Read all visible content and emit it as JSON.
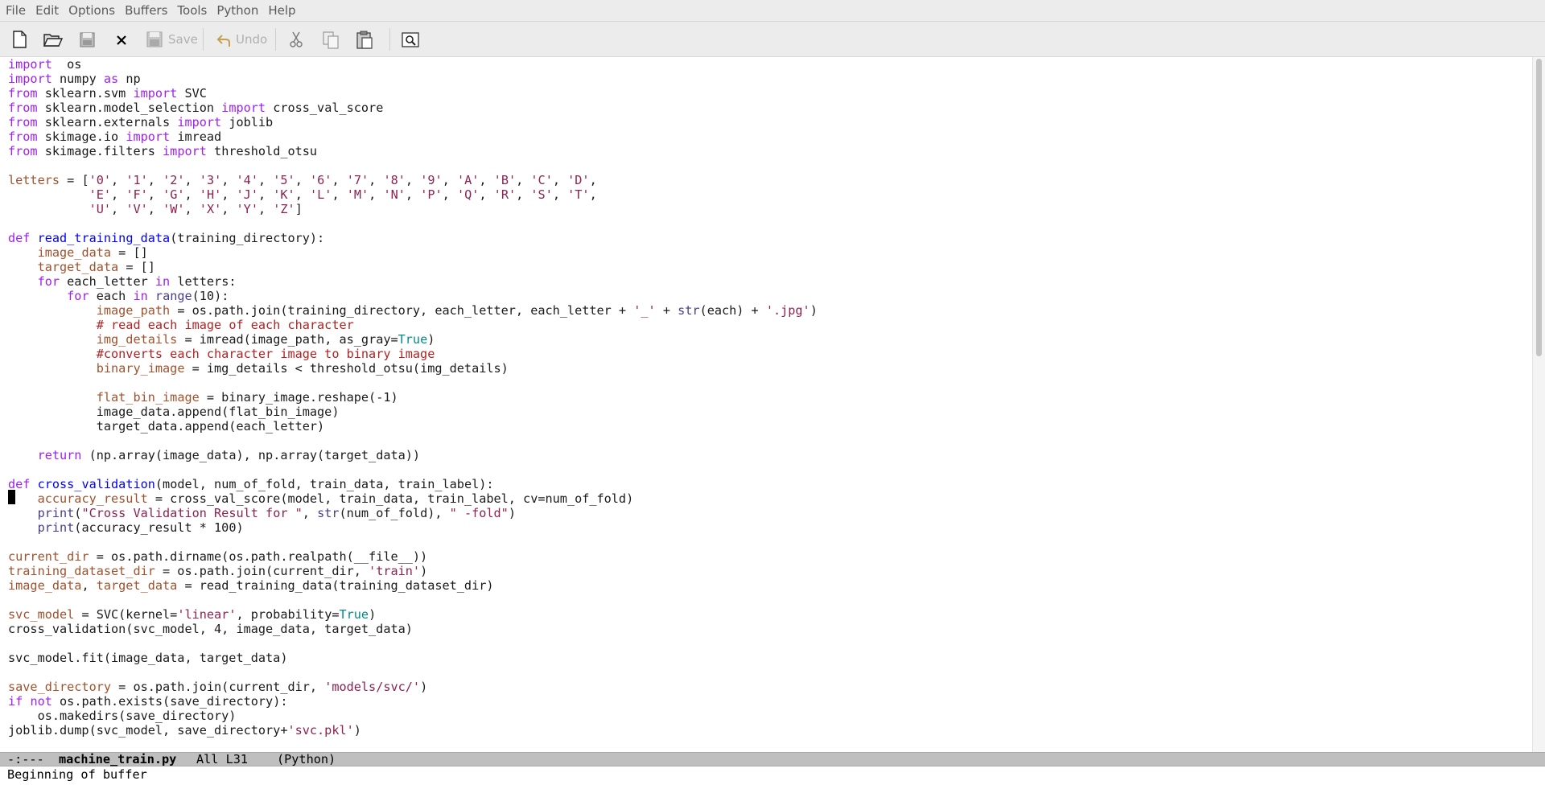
{
  "menu": [
    "File",
    "Edit",
    "Options",
    "Buffers",
    "Tools",
    "Python",
    "Help"
  ],
  "toolbar": {
    "save_label": "Save",
    "undo_label": "Undo"
  },
  "code_lines": [
    [
      [
        "kw",
        "import"
      ],
      [
        "",
        "  os"
      ]
    ],
    [
      [
        "kw",
        "import"
      ],
      [
        "",
        " numpy "
      ],
      [
        "kw",
        "as"
      ],
      [
        "",
        " np"
      ]
    ],
    [
      [
        "kw",
        "from"
      ],
      [
        "",
        " sklearn.svm "
      ],
      [
        "kw",
        "import"
      ],
      [
        "",
        " SVC"
      ]
    ],
    [
      [
        "kw",
        "from"
      ],
      [
        "",
        " sklearn.model_selection "
      ],
      [
        "kw",
        "import"
      ],
      [
        "",
        " cross_val_score"
      ]
    ],
    [
      [
        "kw",
        "from"
      ],
      [
        "",
        " sklearn.externals "
      ],
      [
        "kw",
        "import"
      ],
      [
        "",
        " joblib"
      ]
    ],
    [
      [
        "kw",
        "from"
      ],
      [
        "",
        " skimage.io "
      ],
      [
        "kw",
        "import"
      ],
      [
        "",
        " imread"
      ]
    ],
    [
      [
        "kw",
        "from"
      ],
      [
        "",
        " skimage.filters "
      ],
      [
        "kw",
        "import"
      ],
      [
        "",
        " threshold_otsu"
      ]
    ],
    [],
    [
      [
        "var",
        "letters"
      ],
      [
        "",
        " = ["
      ],
      [
        "str",
        "'0'"
      ],
      [
        "",
        ", "
      ],
      [
        "str",
        "'1'"
      ],
      [
        "",
        ", "
      ],
      [
        "str",
        "'2'"
      ],
      [
        "",
        ", "
      ],
      [
        "str",
        "'3'"
      ],
      [
        "",
        ", "
      ],
      [
        "str",
        "'4'"
      ],
      [
        "",
        ", "
      ],
      [
        "str",
        "'5'"
      ],
      [
        "",
        ", "
      ],
      [
        "str",
        "'6'"
      ],
      [
        "",
        ", "
      ],
      [
        "str",
        "'7'"
      ],
      [
        "",
        ", "
      ],
      [
        "str",
        "'8'"
      ],
      [
        "",
        ", "
      ],
      [
        "str",
        "'9'"
      ],
      [
        "",
        ", "
      ],
      [
        "str",
        "'A'"
      ],
      [
        "",
        ", "
      ],
      [
        "str",
        "'B'"
      ],
      [
        "",
        ", "
      ],
      [
        "str",
        "'C'"
      ],
      [
        "",
        ", "
      ],
      [
        "str",
        "'D'"
      ],
      [
        "",
        ","
      ]
    ],
    [
      [
        "",
        "           "
      ],
      [
        "str",
        "'E'"
      ],
      [
        "",
        ", "
      ],
      [
        "str",
        "'F'"
      ],
      [
        "",
        ", "
      ],
      [
        "str",
        "'G'"
      ],
      [
        "",
        ", "
      ],
      [
        "str",
        "'H'"
      ],
      [
        "",
        ", "
      ],
      [
        "str",
        "'J'"
      ],
      [
        "",
        ", "
      ],
      [
        "str",
        "'K'"
      ],
      [
        "",
        ", "
      ],
      [
        "str",
        "'L'"
      ],
      [
        "",
        ", "
      ],
      [
        "str",
        "'M'"
      ],
      [
        "",
        ", "
      ],
      [
        "str",
        "'N'"
      ],
      [
        "",
        ", "
      ],
      [
        "str",
        "'P'"
      ],
      [
        "",
        ", "
      ],
      [
        "str",
        "'Q'"
      ],
      [
        "",
        ", "
      ],
      [
        "str",
        "'R'"
      ],
      [
        "",
        ", "
      ],
      [
        "str",
        "'S'"
      ],
      [
        "",
        ", "
      ],
      [
        "str",
        "'T'"
      ],
      [
        "",
        ","
      ]
    ],
    [
      [
        "",
        "           "
      ],
      [
        "str",
        "'U'"
      ],
      [
        "",
        ", "
      ],
      [
        "str",
        "'V'"
      ],
      [
        "",
        ", "
      ],
      [
        "str",
        "'W'"
      ],
      [
        "",
        ", "
      ],
      [
        "str",
        "'X'"
      ],
      [
        "",
        ", "
      ],
      [
        "str",
        "'Y'"
      ],
      [
        "",
        ", "
      ],
      [
        "str",
        "'Z'"
      ],
      [
        "",
        "]"
      ]
    ],
    [],
    [
      [
        "kw",
        "def"
      ],
      [
        "",
        " "
      ],
      [
        "fn",
        "read_training_data"
      ],
      [
        "",
        "(training_directory):"
      ]
    ],
    [
      [
        "",
        "    "
      ],
      [
        "var",
        "image_data"
      ],
      [
        "",
        " = []"
      ]
    ],
    [
      [
        "",
        "    "
      ],
      [
        "var",
        "target_data"
      ],
      [
        "",
        " = []"
      ]
    ],
    [
      [
        "",
        "    "
      ],
      [
        "kw",
        "for"
      ],
      [
        "",
        " each_letter "
      ],
      [
        "kw",
        "in"
      ],
      [
        "",
        " letters:"
      ]
    ],
    [
      [
        "",
        "        "
      ],
      [
        "kw",
        "for"
      ],
      [
        "",
        " each "
      ],
      [
        "kw",
        "in"
      ],
      [
        "",
        " "
      ],
      [
        "bi",
        "range"
      ],
      [
        "",
        "(10):"
      ]
    ],
    [
      [
        "",
        "            "
      ],
      [
        "var",
        "image_path"
      ],
      [
        "",
        " = os.path.join(training_directory, each_letter, each_letter + "
      ],
      [
        "str",
        "'_'"
      ],
      [
        "",
        " + "
      ],
      [
        "bi",
        "str"
      ],
      [
        "",
        "(each) + "
      ],
      [
        "str",
        "'.jpg'"
      ],
      [
        "",
        ")"
      ]
    ],
    [
      [
        "",
        "            "
      ],
      [
        "cmt",
        "# read each image of each character"
      ]
    ],
    [
      [
        "",
        "            "
      ],
      [
        "var",
        "img_details"
      ],
      [
        "",
        " = imread(image_path, as_gray="
      ],
      [
        "const",
        "True"
      ],
      [
        "",
        ")"
      ]
    ],
    [
      [
        "",
        "            "
      ],
      [
        "cmt",
        "#converts each character image to binary image"
      ]
    ],
    [
      [
        "",
        "            "
      ],
      [
        "var",
        "binary_image"
      ],
      [
        "",
        " = img_details < threshold_otsu(img_details)"
      ]
    ],
    [],
    [
      [
        "",
        "            "
      ],
      [
        "var",
        "flat_bin_image"
      ],
      [
        "",
        " = binary_image.reshape(-1)"
      ]
    ],
    [
      [
        "",
        "            image_data.append(flat_bin_image)"
      ]
    ],
    [
      [
        "",
        "            target_data.append(each_letter)"
      ]
    ],
    [],
    [
      [
        "",
        "    "
      ],
      [
        "kw",
        "return"
      ],
      [
        "",
        " (np.array(image_data), np.array(target_data))"
      ]
    ],
    [],
    [
      [
        "kw",
        "def"
      ],
      [
        "",
        " "
      ],
      [
        "fn",
        "cross_validation"
      ],
      [
        "",
        "(model, num_of_fold, train_data, train_label):"
      ]
    ],
    [
      [
        "",
        "    "
      ],
      [
        "var",
        "accuracy_result"
      ],
      [
        "",
        " = cross_val_score(model, train_data, train_label, cv=num_of_fold)"
      ]
    ],
    [
      [
        "",
        "    "
      ],
      [
        "bi",
        "print"
      ],
      [
        "",
        "("
      ],
      [
        "str",
        "\"Cross Validation Result for \""
      ],
      [
        "",
        ", "
      ],
      [
        "bi",
        "str"
      ],
      [
        "",
        "(num_of_fold), "
      ],
      [
        "str",
        "\" -fold\""
      ],
      [
        "",
        ")"
      ]
    ],
    [
      [
        "",
        "    "
      ],
      [
        "bi",
        "print"
      ],
      [
        "",
        "(accuracy_result * 100)"
      ]
    ],
    [],
    [
      [
        "var",
        "current_dir"
      ],
      [
        "",
        " = os.path.dirname(os.path.realpath(__file__))"
      ]
    ],
    [
      [
        "var",
        "training_dataset_dir"
      ],
      [
        "",
        " = os.path.join(current_dir, "
      ],
      [
        "str",
        "'train'"
      ],
      [
        "",
        ")"
      ]
    ],
    [
      [
        "var",
        "image_data"
      ],
      [
        "",
        ", "
      ],
      [
        "var",
        "target_data"
      ],
      [
        "",
        " = read_training_data(training_dataset_dir)"
      ]
    ],
    [],
    [
      [
        "var",
        "svc_model"
      ],
      [
        "",
        " = SVC(kernel="
      ],
      [
        "str",
        "'linear'"
      ],
      [
        "",
        ", probability="
      ],
      [
        "const",
        "True"
      ],
      [
        "",
        ")"
      ]
    ],
    [
      [
        "",
        "cross_validation(svc_model, 4, image_data, target_data)"
      ]
    ],
    [],
    [
      [
        "",
        "svc_model.fit(image_data, target_data)"
      ]
    ],
    [],
    [
      [
        "var",
        "save_directory"
      ],
      [
        "",
        " = os.path.join(current_dir, "
      ],
      [
        "str",
        "'models/svc/'"
      ],
      [
        "",
        ")"
      ]
    ],
    [
      [
        "kw",
        "if"
      ],
      [
        "",
        " "
      ],
      [
        "kw",
        "not"
      ],
      [
        "",
        " os.path.exists(save_directory):"
      ]
    ],
    [
      [
        "",
        "    os.makedirs(save_directory)"
      ]
    ],
    [
      [
        "",
        "joblib.dump(svc_model, save_directory+"
      ],
      [
        "str",
        "'svc.pkl'"
      ],
      [
        "",
        ")"
      ]
    ]
  ],
  "modeline": {
    "status": "-:---",
    "buffer_name": "machine_train.py",
    "position": "All L31",
    "mode": "(Python)"
  },
  "echo_area": "Beginning of buffer"
}
